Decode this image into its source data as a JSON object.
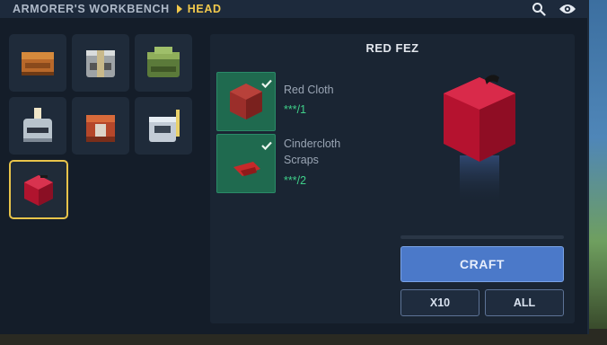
{
  "header": {
    "title": "ARMORER'S WORKBENCH",
    "current": "HEAD",
    "icons": [
      "search-icon",
      "eye-icon"
    ]
  },
  "recipes": [
    {
      "name": "orange-leather-helmet",
      "selected": false
    },
    {
      "name": "steel-banded-helmet",
      "selected": false
    },
    {
      "name": "green-leaf-helmet",
      "selected": false
    },
    {
      "name": "plumed-knight-helmet",
      "selected": false
    },
    {
      "name": "red-bronze-helmet",
      "selected": false
    },
    {
      "name": "winged-steel-helmet",
      "selected": false
    },
    {
      "name": "red-fez",
      "selected": true
    }
  ],
  "selected_item": {
    "name": "RED FEZ",
    "materials": [
      {
        "name": "Red Cloth",
        "quantity": "***/1",
        "satisfied": true
      },
      {
        "name_line1": "Cindercloth",
        "name_line2": "Scraps",
        "quantity": "***/2",
        "satisfied": true
      }
    ]
  },
  "craft_progress": 0,
  "actions": {
    "craft": "CRAFT",
    "x10": "X10",
    "all": "ALL"
  },
  "colors": {
    "accent": "#f2c94c",
    "craft_button": "#4b79c9",
    "material_bg": "#1f6a4f",
    "quantity_ok": "#3fd08a"
  }
}
